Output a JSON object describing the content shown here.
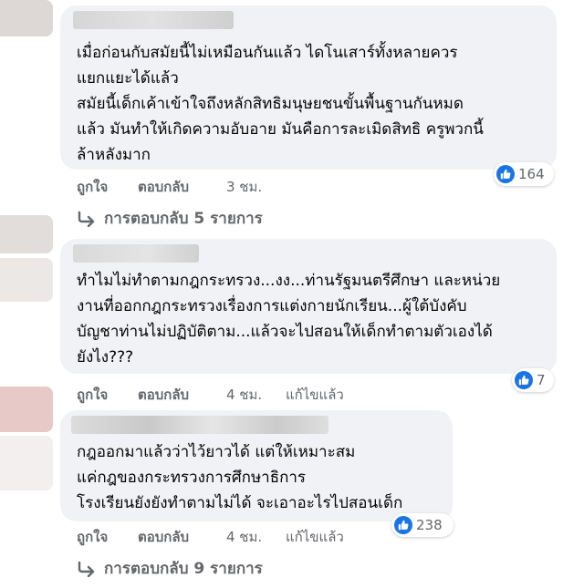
{
  "comments": [
    {
      "lines": [
        "เมื่อก่อนกับสมัยนี้ไม่เหมือนกันแล้ว ไดโนเสาร์ทั้งหลายควร",
        "แยกแยะได้แล้ว",
        "สมัยนี้เด็กเค้าเข้าใจถึงหลักสิทธิมนุษยชนขั้นพื้นฐานกันหมด",
        "แล้ว มันทำให้เกิดความอับอาย มันคือการละเมิดสิทธิ ครูพวกนี้",
        "ล้าหลังมาก"
      ],
      "reactions": "164",
      "like_label": "ถูกใจ",
      "reply_label": "ตอบกลับ",
      "time": "3 ชม.",
      "edited": "",
      "replies_label": "การตอบกลับ 5 รายการ"
    },
    {
      "lines": [
        "ทำไมไม่ทำตามกฎกระทรวง...งง...ท่านรัฐมนตรีศึกษา และหน่วย",
        "งานที่ออกกฎกระทรวงเรื่องการแต่งกายนักเรียน...ผู้ใต้บังคับ",
        "บัญชาท่านไม่ปฏิบัติตาม...แล้วจะไปสอนให้เด็กทำตามตัวเองได้",
        "ยังไง???"
      ],
      "reactions": "7",
      "like_label": "ถูกใจ",
      "reply_label": "ตอบกลับ",
      "time": "4 ชม.",
      "edited": "แก้ไขแล้ว",
      "replies_label": ""
    },
    {
      "lines": [
        "กฎออกมาแล้วว่าไว้ยาวได้ แต่ให้เหมาะสม",
        "แค่กฎของกระทรวงการศึกษาธิการ",
        "โรงเรียนยังยังทำตามไม่ได้ จะเอาอะไรไปสอนเด็ก"
      ],
      "reactions": "238",
      "like_label": "ถูกใจ",
      "reply_label": "ตอบกลับ",
      "time": "4 ชม.",
      "edited": "แก้ไขแล้ว",
      "replies_label": "การตอบกลับ 9 รายการ"
    }
  ],
  "colors": {
    "bubble": "#f0f2f5",
    "like_blue": "#1b74e4",
    "meta_gray": "#65676b"
  },
  "icons": {
    "reaction": "like-thumb-icon",
    "replies": "reply-arrow-icon"
  }
}
